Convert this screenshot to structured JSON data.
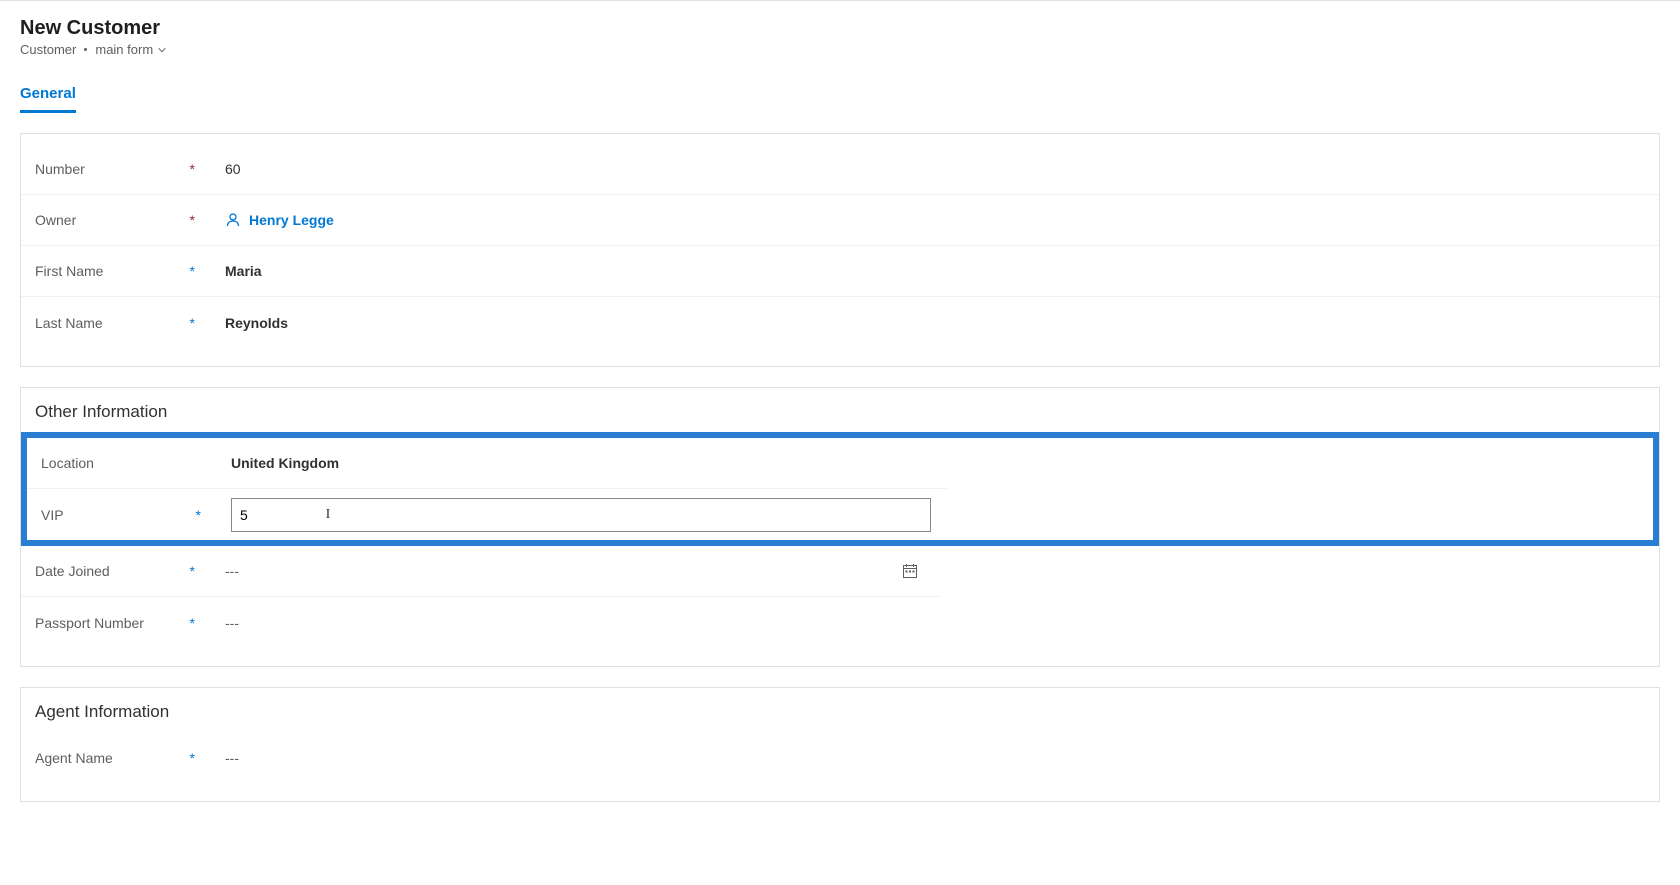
{
  "header": {
    "title": "New Customer",
    "entity": "Customer",
    "form_name": "main form"
  },
  "tabs": {
    "general": "General"
  },
  "fields": {
    "number": {
      "label": "Number",
      "value": "60"
    },
    "owner": {
      "label": "Owner",
      "value": "Henry Legge"
    },
    "first_name": {
      "label": "First Name",
      "value": "Maria"
    },
    "last_name": {
      "label": "Last Name",
      "value": "Reynolds"
    }
  },
  "sections": {
    "other_info": {
      "title": "Other Information",
      "location": {
        "label": "Location",
        "value": "United Kingdom"
      },
      "vip": {
        "label": "VIP",
        "value": "5"
      },
      "date_joined": {
        "label": "Date Joined",
        "placeholder": "---"
      },
      "passport_number": {
        "label": "Passport Number",
        "placeholder": "---"
      }
    },
    "agent_info": {
      "title": "Agent Information",
      "agent_name": {
        "label": "Agent Name",
        "placeholder": "---"
      }
    }
  },
  "highlight_color": "#2b7cd3"
}
